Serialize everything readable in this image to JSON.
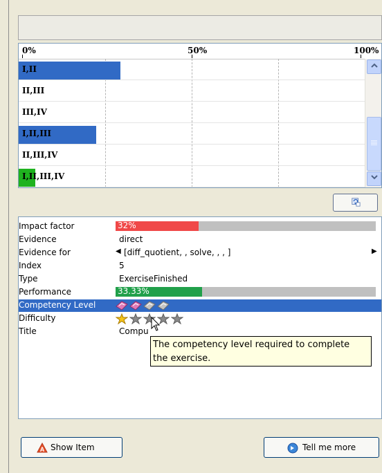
{
  "chart_data": {
    "type": "bar",
    "orientation": "horizontal",
    "x_ticks": [
      "0%",
      "50%",
      "100%"
    ],
    "xlim": [
      0,
      100
    ],
    "grid": true,
    "categories": [
      "I,II",
      "II,III",
      "III,IV",
      "I,II,III",
      "II,III,IV",
      "I,II,III,IV"
    ],
    "values": [
      30,
      0,
      0,
      23,
      0,
      5
    ],
    "colors": [
      "#316ac5",
      null,
      null,
      "#316ac5",
      null,
      "#1fb21f"
    ]
  },
  "properties": {
    "impact_factor": {
      "label": "Impact factor",
      "value_text": "32%",
      "fraction": 0.32,
      "color": "#f04848"
    },
    "evidence": {
      "label": "Evidence",
      "value": "direct"
    },
    "evidence_for": {
      "label": "Evidence for",
      "value": "[diff_quotient, , solve, , , ]"
    },
    "index": {
      "label": "Index",
      "value": "5"
    },
    "type": {
      "label": "Type",
      "value": "ExerciseFinished"
    },
    "performance": {
      "label": "Performance",
      "value_text": "33.33%",
      "fraction": 0.3333,
      "color": "#21a04a"
    },
    "competency_level": {
      "label": "Competency Level",
      "level": 2,
      "max": 4,
      "icon": "gem-icon"
    },
    "difficulty": {
      "label": "Difficulty",
      "stars": 1,
      "max": 5,
      "icon": "star-icon"
    },
    "title": {
      "label": "Title",
      "value": "Compu"
    }
  },
  "tooltip": {
    "line1": "The competency level required to complete",
    "line2": "the exercise."
  },
  "buttons": {
    "show_item": "Show Item",
    "tell_me_more": "Tell me more"
  },
  "colors": {
    "selection": "#316ac5",
    "bar_blue": "#316ac5",
    "bar_green": "#1fb21f"
  }
}
